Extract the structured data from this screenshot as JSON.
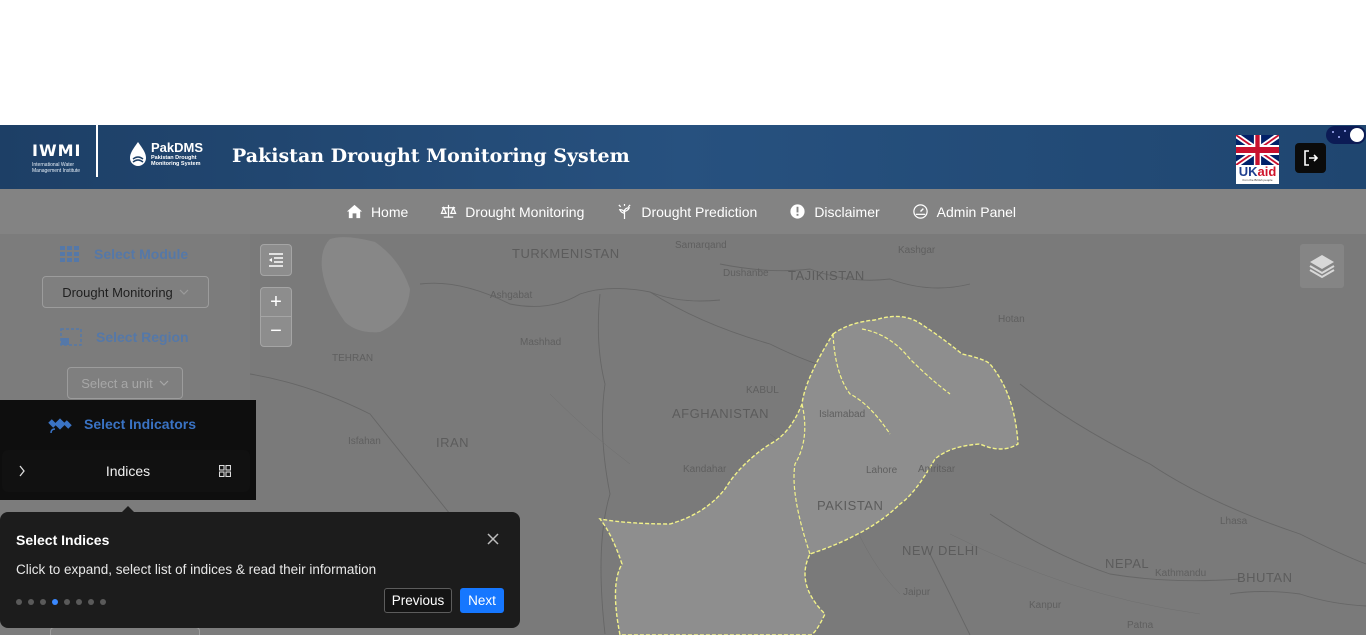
{
  "header": {
    "title": "Pakistan Drought Monitoring System",
    "iwmi_logo": "IWMI",
    "iwmi_sub": "International Water Management Institute",
    "pakdms_logo": "PakDMS",
    "pakdms_sub": "Pakistan Drought Monitoring System",
    "ukaid": {
      "uk": "UK",
      "aid": "aid",
      "tagline": "from the British people"
    },
    "logout_icon": "logout-icon",
    "theme_toggle": "dark"
  },
  "nav": [
    {
      "label": "Home",
      "icon": "home-icon"
    },
    {
      "label": "Drought Monitoring",
      "icon": "balance-scale-icon"
    },
    {
      "label": "Drought Prediction",
      "icon": "plant-sun-icon"
    },
    {
      "label": "Disclaimer",
      "icon": "exclamation-circle-icon"
    },
    {
      "label": "Admin Panel",
      "icon": "dashboard-icon"
    }
  ],
  "sidebar": {
    "module_heading": "Select Module",
    "module_value": "Drought Monitoring",
    "region_heading": "Select Region",
    "region_placeholder": "Select a unit",
    "indicators_heading": "Select Indicators",
    "indices_label": "Indices"
  },
  "map": {
    "zoom_in": "+",
    "zoom_out": "−",
    "labels": {
      "turkmenistan": "TURKMENISTAN",
      "samarqand": "Samarqand",
      "dushanbe": "Dushanbe",
      "tajikistan": "TAJIKISTAN",
      "kashgar": "Kashgar",
      "ashgabat": "Ashgabat",
      "mashhad": "Mashhad",
      "hotan": "Hotan",
      "tehran": "TEHRAN",
      "kabul": "KABUL",
      "afghanistan": "AFGHANISTAN",
      "islamabad": "Islamabad",
      "isfahan": "Isfahan",
      "iran": "IRAN",
      "kandahar": "Kandahar",
      "lahore": "Lahore",
      "amritsar": "Amritsar",
      "pakistan": "PAKISTAN",
      "lhasa": "Lhasa",
      "new_delhi": "NEW DELHI",
      "nepal": "NEPAL",
      "kathmandu": "Kathmandu",
      "bhutan": "BHUTAN",
      "jaipur": "Jaipur",
      "kanpur": "Kanpur",
      "patna": "Patna"
    }
  },
  "tour": {
    "title": "Select Indices",
    "description": "Click to expand, select list of indices & read their information",
    "step": 4,
    "total_steps": 8,
    "previous_label": "Previous",
    "next_label": "Next"
  }
}
